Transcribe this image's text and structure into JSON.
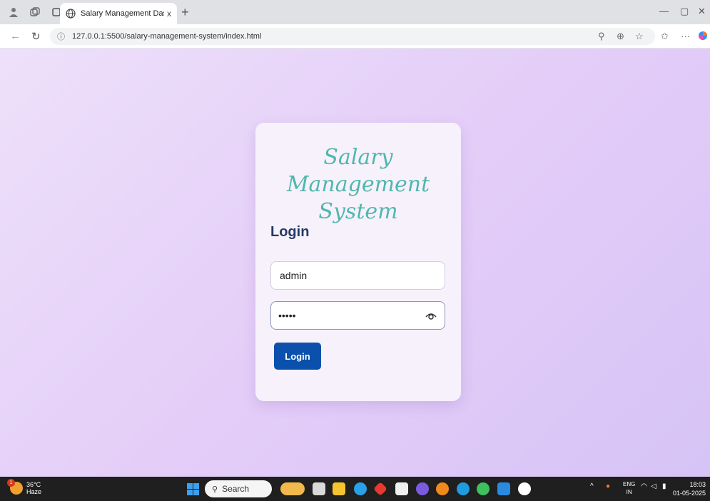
{
  "browser": {
    "tab_title": "Salary Management Dashboard",
    "tab_close": "x",
    "new_tab": "+",
    "url": "127.0.0.1:5500/salary-management-system/index.html"
  },
  "page": {
    "app_title": "Salary Management System",
    "login_heading": "Login",
    "username_value": "admin",
    "password_value": "•••••",
    "login_button": "Login"
  },
  "taskbar": {
    "temperature": "36°C",
    "weather": "Haze",
    "weather_badge": "1",
    "search_label": "Search",
    "language": "ENG",
    "region": "IN",
    "time": "18:03",
    "date": "01-05-2025"
  },
  "colors": {
    "accent_button": "#0b50ad",
    "title_teal": "#4fb7ae",
    "heading_navy": "#233a64"
  }
}
